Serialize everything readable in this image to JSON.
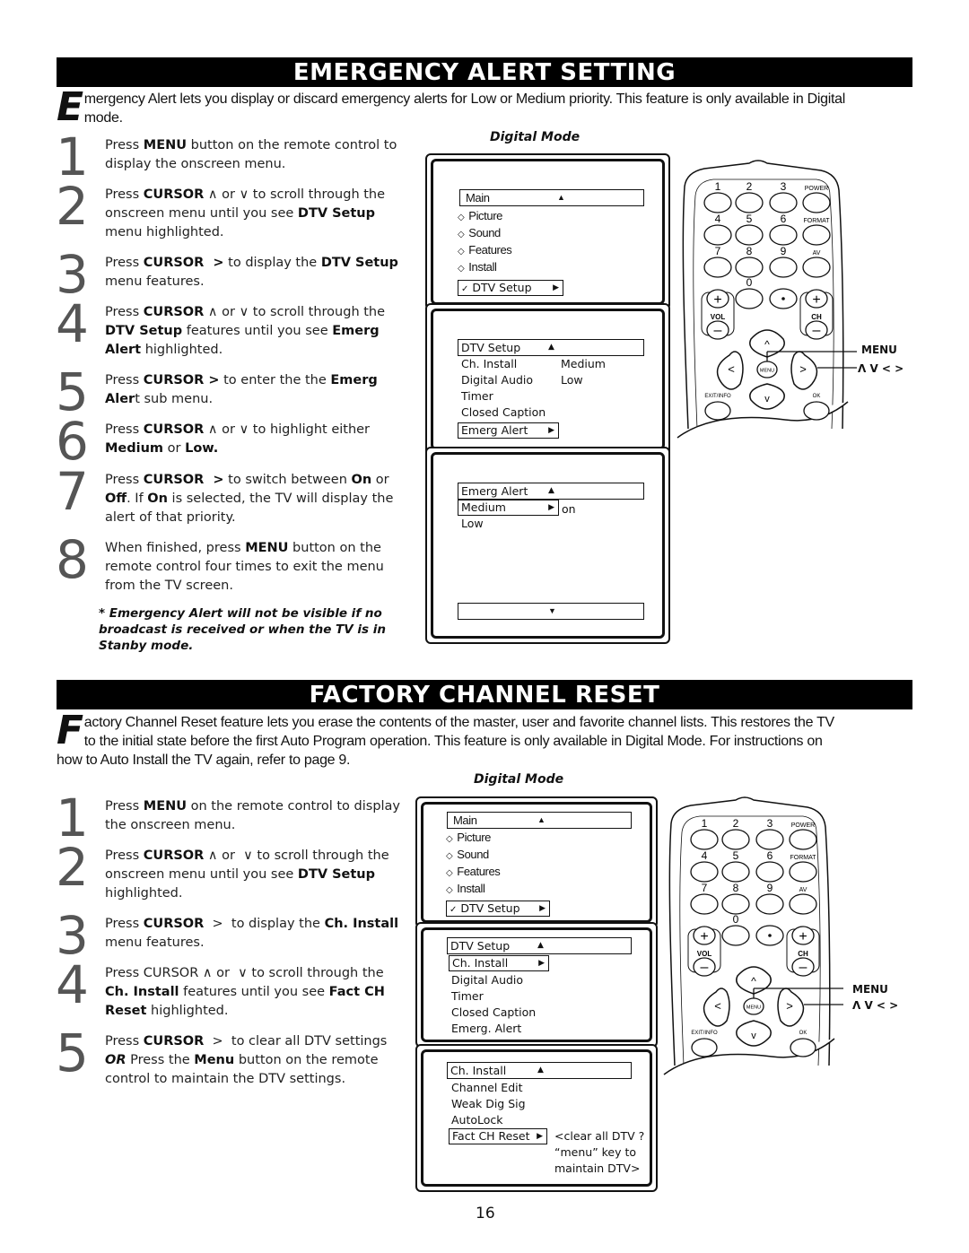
{
  "section1": {
    "title": "EMERGENCY ALERT SETTING",
    "intro_dropcap": "E",
    "intro_line1": "mergency Alert lets you display or discard emergency alerts for Low or Medium priority.  This feature is only available in Digital",
    "intro_line2": "mode.",
    "mode_label": "Digital Mode",
    "steps": [
      {
        "num": "1",
        "html": "Press <b>MENU</b> button on the remote control to display the onscreen menu."
      },
      {
        "num": "2",
        "html": "Press <b>CURSOR</b> &#8743; or &#8744;  to scroll through the onscreen menu until you see <b>DTV Setup</b> menu highlighted."
      },
      {
        "num": "3",
        "html": "Press <b>CURSOR &nbsp;&gt;</b> to display the <b>DTV Setup</b> menu features."
      },
      {
        "num": "4",
        "html": "Press <b>CURSOR</b> &#8743; or &#8744; to scroll through the <b>DTV Setup</b> features until you see <b>Emerg Alert</b> highlighted."
      },
      {
        "num": "5",
        "html": "Press <b>CURSOR &gt;</b> to enter the the <b>Emerg Aler</b>t sub menu."
      },
      {
        "num": "6",
        "html": "Press <b>CURSOR</b> &#8743; or &#8744;  to highlight either <b>Medium</b> or <b>Low.</b>"
      },
      {
        "num": "7",
        "html": "Press <b>CURSOR &nbsp;&gt;</b>  to switch between <b>On</b> or <b>Off</b>.  If <b>On</b> is selected, the TV will display the alert of that priority."
      },
      {
        "num": "8",
        "html": "When finished, press <b>MENU</b> button on the remote control four times to exit the menu from the TV screen."
      }
    ],
    "note": "* Emergency Alert will not be visible if no broadcast is received or when the TV is in Stanby mode.",
    "screen1": {
      "header": "Main",
      "items": [
        "Picture",
        "Sound",
        "Features",
        "Install"
      ],
      "selected": "DTV Setup"
    },
    "screen2": {
      "header": "DTV Setup",
      "items": [
        "Ch. Install",
        "Digital Audio",
        "Timer",
        "Closed Caption"
      ],
      "side_items": [
        "Medium",
        "Low"
      ],
      "selected": "Emerg Alert"
    },
    "screen3": {
      "header": "Emerg Alert",
      "selected": "Medium",
      "selected_value": "on",
      "items": [
        "Low"
      ]
    }
  },
  "section2": {
    "title": "FACTORY CHANNEL RESET",
    "intro_dropcap": "F",
    "intro_line1": "actory Channel Reset feature lets you erase the contents of the master, user and favorite channel lists.  This restores the TV",
    "intro_line2": "to the initial state before the first Auto Program operation.  This feature is only available in Digital Mode.   For instructions on",
    "intro_line3": "how to Auto Install the TV again, refer to page 9.",
    "mode_label": "Digital Mode",
    "steps": [
      {
        "num": "1",
        "html": "Press <b>MENU</b> on the remote control to display the onscreen menu."
      },
      {
        "num": "2",
        "html": "Press <b>CURSOR</b> &#8743; or &nbsp;&#8744; to scroll through the onscreen menu until you see <b>DTV Setup</b> highlighted."
      },
      {
        "num": "3",
        "html": "Press <b>CURSOR</b> &nbsp;&gt;&nbsp; to display the <b>Ch. Install</b> menu features."
      },
      {
        "num": "4",
        "html": "Press CURSOR &#8743; or &nbsp;&#8744; to scroll through the <b>Ch. Install</b> features until you see <b>Fact CH Reset</b> highlighted."
      },
      {
        "num": "5",
        "html": "Press <b>CURSOR</b> &nbsp;&gt;&nbsp; to clear all DTV settings <b><i>OR</i></b>  Press the <b>Menu</b> button on the remote control to maintain the DTV settings."
      }
    ],
    "screen1": {
      "header": "Main",
      "items": [
        "Picture",
        "Sound",
        "Features",
        "Install"
      ],
      "selected": "DTV Setup"
    },
    "screen2": {
      "header": "DTV Setup",
      "selected": "Ch. Install",
      "items": [
        "Digital Audio",
        "Timer",
        "Closed Caption",
        "Emerg. Alert"
      ]
    },
    "screen3": {
      "header": "Ch. Install",
      "items": [
        "Channel Edit",
        "Weak Dig Sig",
        "AutoLock"
      ],
      "selected": "Fact CH Reset",
      "message": [
        "<clear all DTV ?",
        "“menu” key to",
        "maintain DTV>"
      ]
    }
  },
  "remote": {
    "keys": [
      "1",
      "2",
      "3",
      "POWER",
      "4",
      "5",
      "6",
      "FORMAT",
      "7",
      "8",
      "9",
      "AV",
      "0",
      "•"
    ],
    "vol_label": "VOL",
    "ch_label": "CH",
    "menu_key": "MENU",
    "exit_label": "EXIT/INFO",
    "ok_label": "OK",
    "callout_menu": "MENU",
    "callout_cursor": "Λ  V  <  >"
  },
  "page_number": "16"
}
